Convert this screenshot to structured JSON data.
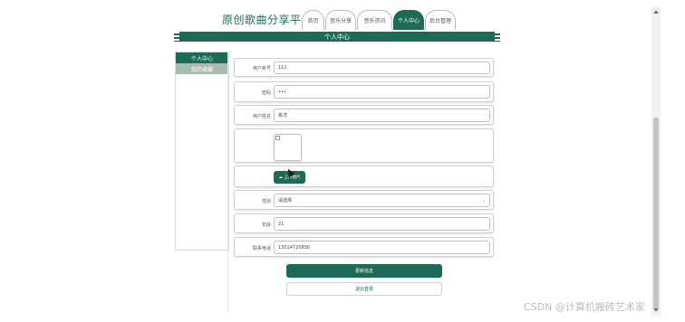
{
  "header": {
    "site_title": "原创歌曲分享平台",
    "nav": [
      {
        "label": "首页",
        "active": false
      },
      {
        "label": "音乐分享",
        "active": false
      },
      {
        "label": "音乐资讯",
        "active": false
      },
      {
        "label": "个人中心",
        "active": true
      },
      {
        "label": "后台管理",
        "active": false
      }
    ]
  },
  "banner": {
    "title": "个人中心"
  },
  "sidebar": {
    "items": [
      {
        "label": "个人中心",
        "active": true
      },
      {
        "label": "我的收藏",
        "active": false
      }
    ]
  },
  "form": {
    "account": {
      "label": "用户账号",
      "value": "111"
    },
    "password": {
      "label": "密码",
      "value": "•••"
    },
    "name": {
      "label": "用户姓名",
      "value": "栋洋"
    },
    "upload_button": "上传图片",
    "gender": {
      "label": "性别",
      "value": "请选择"
    },
    "age": {
      "label": "年龄",
      "value": "21"
    },
    "phone": {
      "label": "联系电话",
      "value": "13014725836"
    },
    "update_button": "更新信息",
    "logout_button": "退出登录"
  },
  "watermark": "CSDN @计算机搬砖艺术家",
  "colors": {
    "primary": "#1d6b57",
    "sidebar_secondary": "#a9bcb2"
  }
}
